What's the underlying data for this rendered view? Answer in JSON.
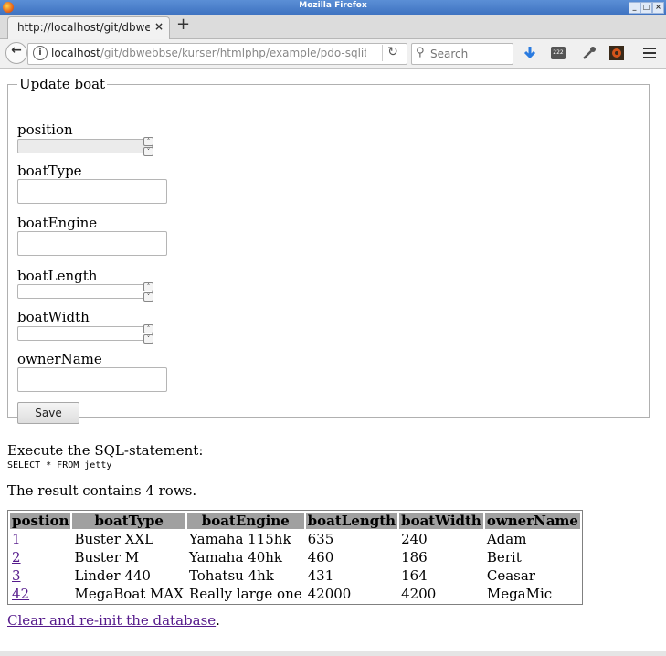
{
  "window": {
    "title": "Mozilla Firefox"
  },
  "tab": {
    "title": "http://localhost/git/dbwebbse/kurser/htmlphp/example/pdo-sqlite/update.php"
  },
  "address": {
    "host": "localhost",
    "path": "/git/dbwebbse/kurser/htmlphp/example/pdo-sqlite/upd"
  },
  "search": {
    "placeholder": "Search"
  },
  "form": {
    "legend": "Update boat",
    "fields": {
      "position": "position",
      "boatType": "boatType",
      "boatEngine": "boatEngine",
      "boatLength": "boatLength",
      "boatWidth": "boatWidth",
      "ownerName": "ownerName"
    },
    "save_label": "Save"
  },
  "sql": {
    "intro": "Execute the SQL-statement:",
    "statement": "SELECT * FROM jetty",
    "result_text": "The result contains 4 rows."
  },
  "table": {
    "headers": [
      "postion",
      "boatType",
      "boatEngine",
      "boatLength",
      "boatWidth",
      "ownerName"
    ],
    "rows": [
      [
        "1",
        "Buster XXL",
        "Yamaha 115hk",
        "635",
        "240",
        "Adam"
      ],
      [
        "2",
        "Buster M",
        "Yamaha 40hk",
        "460",
        "186",
        "Berit"
      ],
      [
        "3",
        "Linder 440",
        "Tohatsu 4hk",
        "431",
        "164",
        "Ceasar"
      ],
      [
        "42",
        "MegaBoat MAX",
        "Really large one",
        "42000",
        "4200",
        "MegaMic"
      ]
    ]
  },
  "footer": {
    "clear_link": "Clear and re-init the database",
    "clear_suffix": "."
  },
  "icons": {
    "download": "download-icon",
    "counter_badge": "222",
    "dropper": "eyedropper-icon",
    "addon": "addon-icon",
    "menu": "hamburger-menu-icon"
  },
  "colors": {
    "titlebar": "#4a7fcc",
    "table_header": "#a0a0a0",
    "visited_link": "#551a8b",
    "download_arrow": "#2a7be0",
    "addon": "#d4541a"
  }
}
